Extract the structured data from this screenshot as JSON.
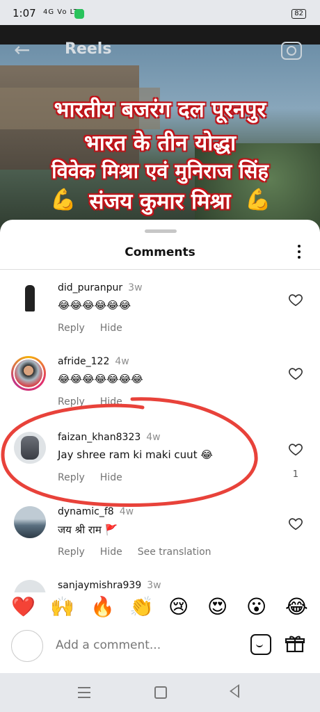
{
  "statusbar": {
    "time": "1:07",
    "network": "4G Vo LTE",
    "battery": "82"
  },
  "header": {
    "title": "Reels"
  },
  "video": {
    "caption_lines": [
      "भारतीय बजरंग दल पूरनपुर",
      "भारत के तीन योद्धा",
      "विवेक मिश्रा एवं मुनिराज सिंह",
      "संजय कुमार मिश्रा"
    ]
  },
  "sheet": {
    "title": "Comments"
  },
  "comments": [
    {
      "username": "did_puranpur",
      "ago": "3w",
      "text": "😂😂😂😂😂😂",
      "reply": "Reply",
      "hide": "Hide"
    },
    {
      "username": "afride_122",
      "ago": "4w",
      "text": "😂😂😂😂😂😂😂",
      "reply": "Reply",
      "hide": "Hide"
    },
    {
      "username": "faizan_khan8323",
      "ago": "4w",
      "text": "Jay shree ram ki maki cuut 😂",
      "reply": "Reply",
      "hide": "Hide",
      "likes": "1"
    },
    {
      "username": "dynamic_f8",
      "ago": "4w",
      "text": "जय श्री राम 🚩",
      "reply": "Reply",
      "hide": "Hide",
      "translate": "See translation"
    },
    {
      "username": "sanjaymishra939",
      "ago": "3w"
    }
  ],
  "emoji_bar": [
    "❤️",
    "🙌",
    "🔥",
    "👏",
    "😢",
    "😍",
    "😮",
    "😂"
  ],
  "input": {
    "placeholder": "Add a comment..."
  },
  "colors": {
    "accent": "#e1306c",
    "annotation": "#e8423a",
    "caption_outline": "#c0141a"
  }
}
